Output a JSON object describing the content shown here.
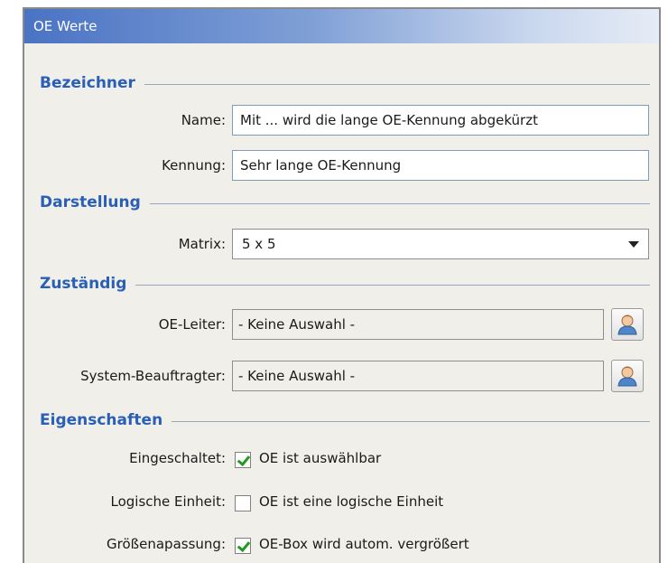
{
  "window": {
    "title": "OE Werte"
  },
  "sections": {
    "bezeichner": "Bezeichner",
    "darstellung": "Darstellung",
    "zustaendig": "Zuständig",
    "eigenschaften": "Eigenschaften"
  },
  "fields": {
    "name": {
      "label": "Name:",
      "value": "Mit ... wird die lange OE-Kennung abgekürzt"
    },
    "kennung": {
      "label": "Kennung:",
      "value": "Sehr lange OE-Kennung"
    },
    "matrix": {
      "label": "Matrix:",
      "value": "5 x 5"
    },
    "oe_leiter": {
      "label": "OE-Leiter:",
      "value": "- Keine Auswahl -"
    },
    "system_beauftragter": {
      "label": "System-Beauftragter:",
      "value": "- Keine Auswahl -"
    }
  },
  "properties": {
    "eingeschaltet": {
      "label": "Eingeschaltet:",
      "text": "OE ist auswählbar",
      "checked": true
    },
    "logische_einheit": {
      "label": "Logische Einheit:",
      "text": "OE ist eine logische Einheit",
      "checked": false
    },
    "groessenanpassung": {
      "label": "Größenapassung:",
      "text": "OE-Box wird autom. vergrößert",
      "checked": true
    }
  },
  "icons": {
    "user_picker": "person-icon"
  },
  "colors": {
    "section_title": "#2a5fb8",
    "check": "#1f9a1f"
  }
}
